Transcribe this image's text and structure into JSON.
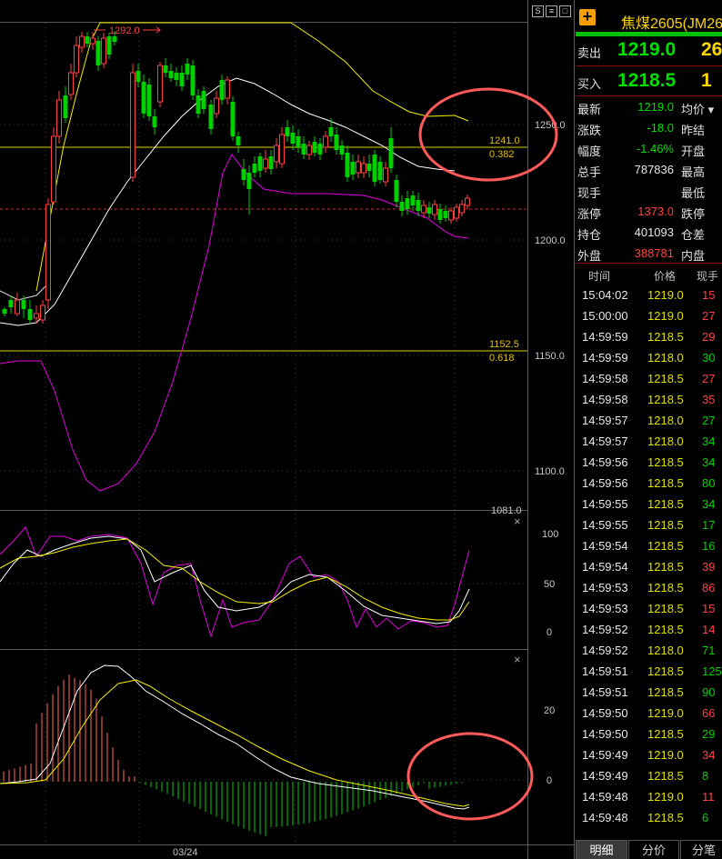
{
  "colors": {
    "up": "#ff4040",
    "down": "#00d000",
    "ma_yellow": "#f5f000",
    "ma_white": "#ffffff",
    "boll_magenta": "#e000e0",
    "circle": "#ff5a5a",
    "label_gold": "#e0c000"
  },
  "chart": {
    "price_ticks": [
      "1250.0",
      "1200.0",
      "1150.0",
      "1100.0",
      "1081.0"
    ],
    "high_label": "1292.0",
    "fib": [
      {
        "price": "1241.0",
        "ratio": "0.382"
      },
      {
        "price": "1152.5",
        "ratio": "0.618"
      }
    ],
    "kdj_ticks": [
      "100",
      "50",
      "0"
    ],
    "macd_ticks": [
      "20",
      "0"
    ],
    "date_label": "03/24",
    "toolbar_icons": [
      "S",
      "≡",
      "□"
    ],
    "close_icon": "×"
  },
  "symbol": {
    "name": "焦煤2605(JM26"
  },
  "orderbook": {
    "ask": {
      "label": "卖出",
      "price": "1219.0",
      "vol": "26"
    },
    "bid": {
      "label": "买入",
      "price": "1218.5",
      "vol": "1"
    }
  },
  "stats": [
    {
      "label": "最新",
      "value": "1219.0",
      "color": "#00e000",
      "right": "均价 ▾"
    },
    {
      "label": "涨跌",
      "value": "-18.0",
      "color": "#00e000",
      "right": "昨结"
    },
    {
      "label": "幅度",
      "value": "-1.46%",
      "color": "#00e000",
      "right": "开盘"
    },
    {
      "label": "总手",
      "value": "787836",
      "color": "#e8e8e8",
      "right": "最高"
    },
    {
      "label": "现手",
      "value": "",
      "color": "#e8e8e8",
      "right": "最低"
    },
    {
      "label": "涨停",
      "value": "1373.0",
      "color": "#ff4040",
      "right": "跌停"
    },
    {
      "label": "持仓",
      "value": "401093",
      "color": "#e8e8e8",
      "right": "仓差"
    },
    {
      "label": "外盘",
      "value": "388781",
      "color": "#ff4040",
      "right": "内盘"
    }
  ],
  "trades_header": {
    "time": "时间",
    "price": "价格",
    "vol": "现手"
  },
  "trades": [
    {
      "time": "15:04:02",
      "price": "1219.0",
      "vol": "15",
      "color": "#ff4040"
    },
    {
      "time": "15:00:00",
      "price": "1219.0",
      "vol": "27",
      "color": "#ff4040"
    },
    {
      "time": "14:59:59",
      "price": "1218.5",
      "vol": "29",
      "color": "#ff4040"
    },
    {
      "time": "14:59:59",
      "price": "1218.0",
      "vol": "30",
      "color": "#00d000"
    },
    {
      "time": "14:59:58",
      "price": "1218.5",
      "vol": "27",
      "color": "#ff4040"
    },
    {
      "time": "14:59:58",
      "price": "1218.5",
      "vol": "35",
      "color": "#ff4040"
    },
    {
      "time": "14:59:57",
      "price": "1218.0",
      "vol": "27",
      "color": "#00d000"
    },
    {
      "time": "14:59:57",
      "price": "1218.0",
      "vol": "34",
      "color": "#00d000"
    },
    {
      "time": "14:59:56",
      "price": "1218.5",
      "vol": "34",
      "color": "#00d000"
    },
    {
      "time": "14:59:56",
      "price": "1218.5",
      "vol": "80",
      "color": "#00d000"
    },
    {
      "time": "14:59:55",
      "price": "1218.5",
      "vol": "34",
      "color": "#00d000"
    },
    {
      "time": "14:59:55",
      "price": "1218.5",
      "vol": "17",
      "color": "#00d000"
    },
    {
      "time": "14:59:54",
      "price": "1218.5",
      "vol": "16",
      "color": "#00d000"
    },
    {
      "time": "14:59:54",
      "price": "1218.5",
      "vol": "39",
      "color": "#ff4040"
    },
    {
      "time": "14:59:53",
      "price": "1218.5",
      "vol": "86",
      "color": "#ff4040"
    },
    {
      "time": "14:59:53",
      "price": "1218.5",
      "vol": "15",
      "color": "#ff4040"
    },
    {
      "time": "14:59:52",
      "price": "1218.5",
      "vol": "14",
      "color": "#ff4040"
    },
    {
      "time": "14:59:52",
      "price": "1218.0",
      "vol": "71",
      "color": "#00d000"
    },
    {
      "time": "14:59:51",
      "price": "1218.5",
      "vol": "125",
      "color": "#00d000"
    },
    {
      "time": "14:59:51",
      "price": "1218.5",
      "vol": "90",
      "color": "#00d000"
    },
    {
      "time": "14:59:50",
      "price": "1219.0",
      "vol": "66",
      "color": "#ff4040"
    },
    {
      "time": "14:59:50",
      "price": "1218.5",
      "vol": "29",
      "color": "#00d000"
    },
    {
      "time": "14:59:49",
      "price": "1219.0",
      "vol": "34",
      "color": "#ff4040"
    },
    {
      "time": "14:59:49",
      "price": "1218.5",
      "vol": "8",
      "color": "#00d000"
    },
    {
      "time": "14:59:48",
      "price": "1219.0",
      "vol": "11",
      "color": "#ff4040"
    },
    {
      "time": "14:59:48",
      "price": "1218.5",
      "vol": "6",
      "color": "#00d000"
    }
  ],
  "tabs": [
    "明细",
    "分价",
    "分笔"
  ]
}
